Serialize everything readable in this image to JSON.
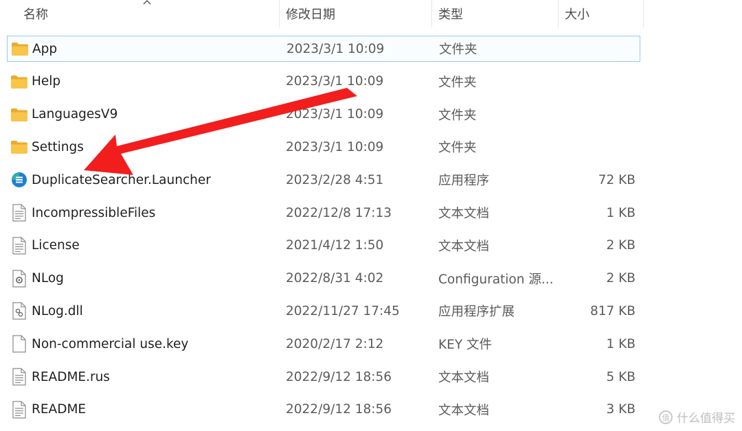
{
  "columns": {
    "name": "名称",
    "date": "修改日期",
    "type": "类型",
    "size": "大小"
  },
  "files": [
    {
      "name": "App",
      "date": "2023/3/1 10:09",
      "type": "文件夹",
      "size": "",
      "icon": "folder-icon"
    },
    {
      "name": "Help",
      "date": "2023/3/1 10:09",
      "type": "文件夹",
      "size": "",
      "icon": "folder-icon"
    },
    {
      "name": "LanguagesV9",
      "date": "2023/3/1 10:09",
      "type": "文件夹",
      "size": "",
      "icon": "folder-icon"
    },
    {
      "name": "Settings",
      "date": "2023/3/1 10:09",
      "type": "文件夹",
      "size": "",
      "icon": "folder-icon"
    },
    {
      "name": "DuplicateSearcher.Launcher",
      "date": "2023/2/28 4:51",
      "type": "应用程序",
      "size": "72 KB",
      "icon": "app-icon"
    },
    {
      "name": "IncompressibleFiles",
      "date": "2022/12/8 17:13",
      "type": "文本文档",
      "size": "1 KB",
      "icon": "text-file-icon"
    },
    {
      "name": "License",
      "date": "2021/4/12 1:50",
      "type": "文本文档",
      "size": "2 KB",
      "icon": "text-file-icon"
    },
    {
      "name": "NLog",
      "date": "2022/8/31 4:02",
      "type": "Configuration 源...",
      "size": "2 KB",
      "icon": "config-file-icon"
    },
    {
      "name": "NLog.dll",
      "date": "2022/11/27 17:45",
      "type": "应用程序扩展",
      "size": "817 KB",
      "icon": "dll-file-icon"
    },
    {
      "name": "Non-commercial use.key",
      "date": "2020/2/17 2:12",
      "type": "KEY 文件",
      "size": "1 KB",
      "icon": "blank-file-icon"
    },
    {
      "name": "README.rus",
      "date": "2022/9/12 18:56",
      "type": "文本文档",
      "size": "5 KB",
      "icon": "text-file-icon"
    },
    {
      "name": "README",
      "date": "2022/9/12 18:56",
      "type": "文本文档",
      "size": "3 KB",
      "icon": "text-file-icon"
    }
  ],
  "selected_index": 0,
  "annotation": {
    "color": "#f21d1d",
    "shape": "arrow"
  },
  "watermark": {
    "text": "什么值得买",
    "logo": "值"
  },
  "colors": {
    "folder": "#f8c54a",
    "selection_border": "#99c7ef",
    "app_icon": "#1d7fd6"
  }
}
